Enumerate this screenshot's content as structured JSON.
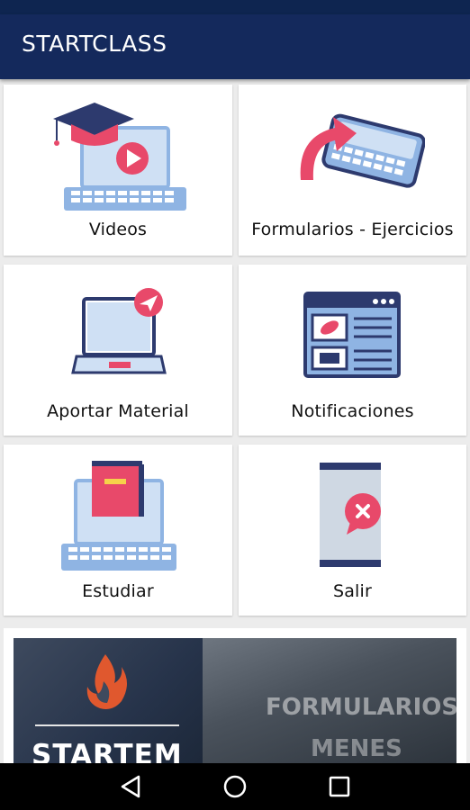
{
  "app": {
    "title": "STARTCLASS"
  },
  "menu": [
    {
      "label": "Videos",
      "icon": "laptop-graduation-cap-play-icon"
    },
    {
      "label": "Formularios - Ejercicios",
      "icon": "phone-keyboard-arrow-icon"
    },
    {
      "label": "Aportar Material",
      "icon": "laptop-paper-plane-icon"
    },
    {
      "label": "Notificaciones",
      "icon": "browser-window-links-icon"
    },
    {
      "label": "Estudiar",
      "icon": "laptop-book-icon"
    },
    {
      "label": "Salir",
      "icon": "phone-close-icon"
    }
  ],
  "banner": {
    "brand": "STARTEM",
    "text_top": "FORMULARIOS",
    "text_bottom": "MENES"
  },
  "navbar": {
    "back": "back-icon",
    "home": "home-icon",
    "recents": "recents-icon"
  },
  "colors": {
    "appbar": "#14295c",
    "accent_pink": "#e8496a",
    "icon_blue": "#8fb4e3",
    "icon_navy": "#2d3a6e"
  }
}
